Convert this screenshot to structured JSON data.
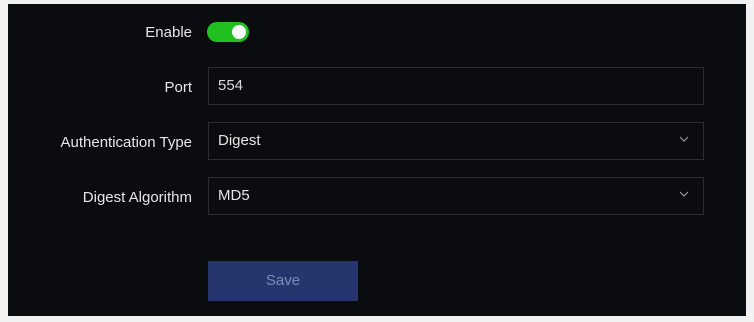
{
  "rtsp_settings": {
    "enable": {
      "label": "Enable",
      "on": true,
      "on_color": "#20c020"
    },
    "port": {
      "label": "Port",
      "value": "554"
    },
    "authentication_type": {
      "label": "Authentication Type",
      "selected": "Digest"
    },
    "digest_algorithm": {
      "label": "Digest Algorithm",
      "selected": "MD5"
    },
    "save_label": "Save"
  },
  "icons": {
    "dropdown": "chevron-down-icon"
  },
  "colors": {
    "panel_bg": "#0b0c0f",
    "field_border": "#2a2c32",
    "button_bg": "#26366d",
    "button_text": "#7b8bbb"
  }
}
